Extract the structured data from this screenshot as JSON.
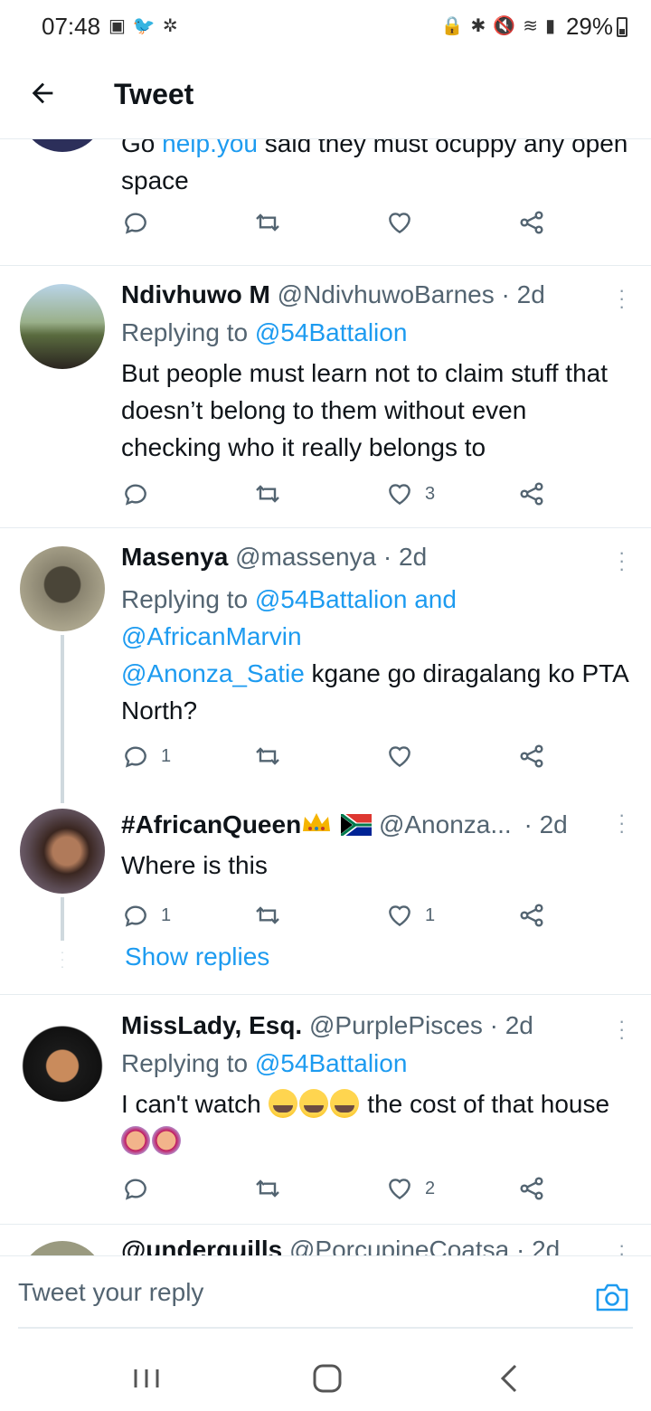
{
  "status_bar": {
    "time": "07:48",
    "battery": "29%",
    "left_icons": [
      "gallery-icon",
      "twitter-icon",
      "pinwheel-icon"
    ],
    "right_icons": [
      "lock-icon",
      "bluetooth-icon",
      "mute-icon",
      "wifi-icon",
      "signal-icon"
    ]
  },
  "header": {
    "title": "Tweet"
  },
  "partial_tweet": {
    "body_prefix": "Go ",
    "link": "help.you",
    "body_suffix": " said they must ocuppy any open space"
  },
  "tweets": [
    {
      "name": "Ndivhuwo M",
      "handle": "@NdivhuwoBarnes",
      "time": "· 2d",
      "replying_prefix": "Replying to ",
      "replying_to": "@54Battalion",
      "body": "But people must learn not to claim stuff that doesn’t belong to them without even checking who it really belongs to",
      "reply_count": "",
      "like_count": "3"
    },
    {
      "name": "Masenya",
      "handle": "@massenya",
      "time": "· 2d",
      "replying_prefix": "Replying to ",
      "replying_to": "@54Battalion and",
      "replying_to_2": "@AfricanMarvin",
      "body_mention": "@Anonza_Satie",
      "body": " kgane go diragalang ko PTA North?",
      "reply_count": "1",
      "like_count": ""
    },
    {
      "name": "#AfricanQueen",
      "handle": "@Anonza...",
      "time": "· 2d",
      "body": "Where is this",
      "reply_count": "1",
      "like_count": "1",
      "show_replies": "Show replies"
    },
    {
      "name": "MissLady, Esq.",
      "handle": "@PurplePisces",
      "time": "· 2d",
      "replying_prefix": "Replying to ",
      "replying_to": "@54Battalion",
      "body_a": "I can't watch ",
      "body_b": " the cost of that house ",
      "reply_count": "",
      "like_count": "2"
    },
    {
      "name": "@underquills",
      "handle": "@PorcupineCoatsa",
      "time": "· 2d"
    }
  ],
  "reply_bar": {
    "placeholder": "Tweet your reply"
  },
  "colors": {
    "link": "#1d9bf0",
    "text": "#0f1419",
    "secondary": "#536471",
    "divider": "#e6ecf0"
  }
}
